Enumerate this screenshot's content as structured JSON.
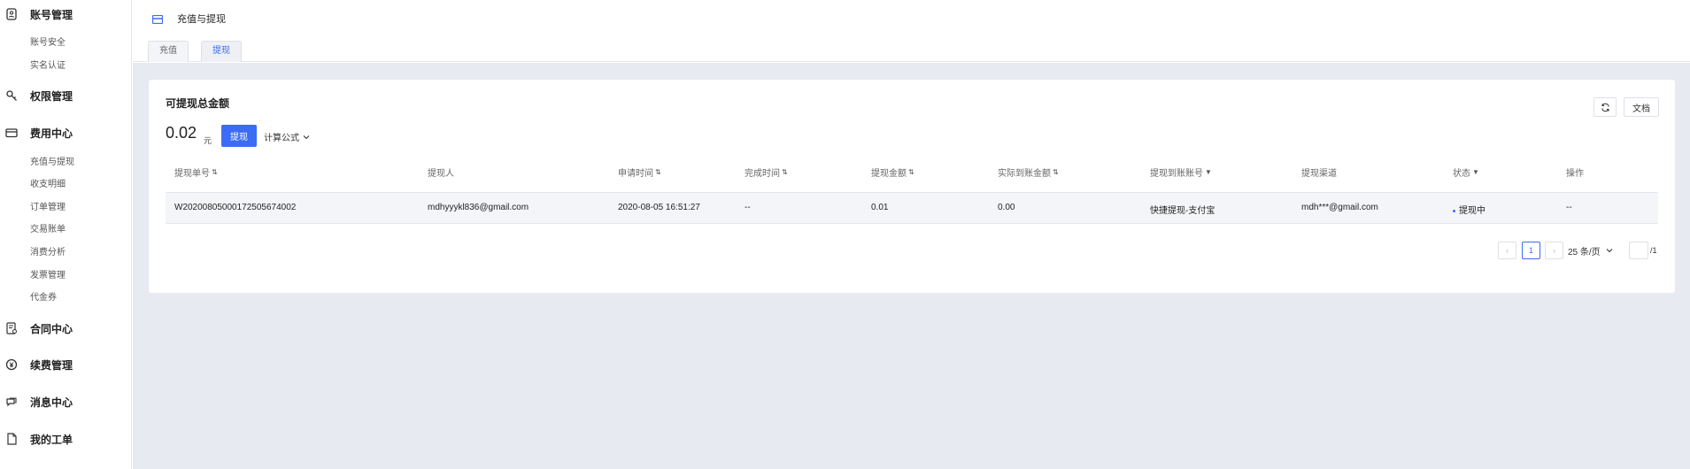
{
  "sidebar": {
    "groups": [
      {
        "label": "账号管理",
        "icon": "account-icon"
      },
      {
        "label": "权限管理",
        "icon": "key-icon"
      },
      {
        "label": "费用中心",
        "icon": "card-icon"
      },
      {
        "label": "合同中心",
        "icon": "contract-icon"
      },
      {
        "label": "续费管理",
        "icon": "yuan-icon"
      },
      {
        "label": "消息中心",
        "icon": "message-icon"
      },
      {
        "label": "我的工单",
        "icon": "ticket-icon"
      }
    ],
    "account_subs": [
      "账号安全",
      "实名认证"
    ],
    "fee_subs": [
      "充值与提现",
      "收支明细",
      "订单管理",
      "交易账单",
      "消费分析",
      "发票管理",
      "代金券"
    ]
  },
  "header": {
    "title": "充值与提现",
    "tabs": [
      "充值",
      "提现"
    ]
  },
  "card": {
    "title": "可提现总金额",
    "amount": "0.02",
    "unit": "元",
    "withdraw_label": "提现",
    "formula_label": "计算公式",
    "doc_label": "文档"
  },
  "table": {
    "headers": [
      "提现单号",
      "提现人",
      "申请时间",
      "完成时间",
      "提现金额",
      "实际到账金额",
      "提现到账账号",
      "提现渠道",
      "状态",
      "操作"
    ],
    "rows": [
      {
        "order_no": "W20200805000172505674002",
        "user": "mdhyyykl836@gmail.com",
        "apply_time": "2020-08-05 16:51:27",
        "finish_time": "--",
        "amount": "0.01",
        "actual_amount": "0.00",
        "account": "快捷提现-支付宝",
        "channel": "mdh***@gmail.com",
        "status": "提现中",
        "action": "--"
      }
    ]
  },
  "pagination": {
    "prev": "‹",
    "current": "1",
    "next": "›",
    "page_size": "25 条/页",
    "total_pages": "/1"
  },
  "colors": {
    "accent": "#3b6cf5",
    "page_bg": "#e8eaf1"
  }
}
